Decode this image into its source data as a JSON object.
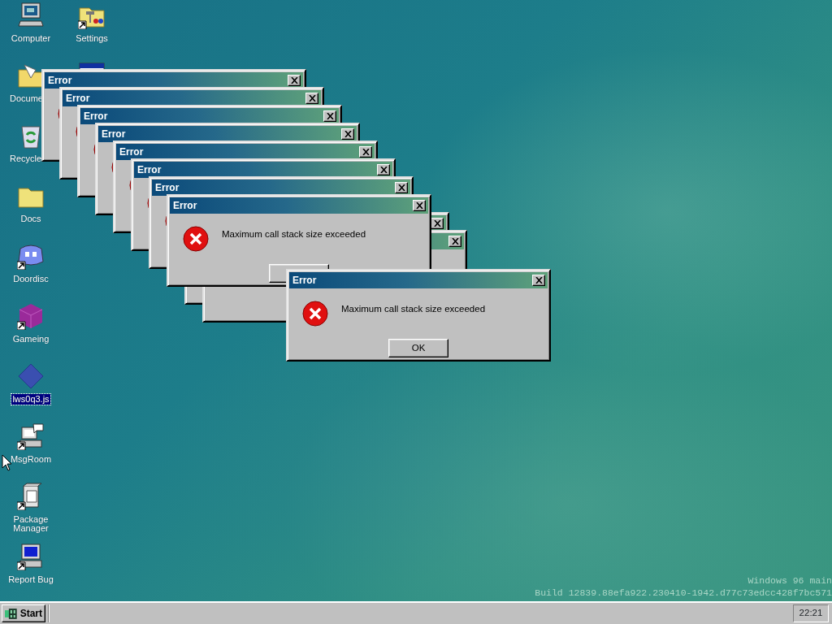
{
  "desktop": {
    "icon_columns": [
      [
        {
          "label": "Computer",
          "kind": "computer",
          "shortcut": false,
          "selected": false,
          "truncated": false
        },
        {
          "label": "Docume",
          "kind": "documents",
          "shortcut": false,
          "selected": false,
          "truncated": true
        },
        {
          "label": "Recycle",
          "kind": "recycle",
          "shortcut": false,
          "selected": false,
          "truncated": true
        },
        {
          "label": "Docs",
          "kind": "folder",
          "shortcut": false,
          "selected": false,
          "truncated": false
        },
        {
          "label": "Doordisc",
          "kind": "chat",
          "shortcut": true,
          "selected": false,
          "truncated": false
        },
        {
          "label": "Gameing",
          "kind": "cube",
          "shortcut": true,
          "selected": false,
          "truncated": false
        },
        {
          "label": "lws0q3.js",
          "kind": "script",
          "shortcut": false,
          "selected": true,
          "truncated": false
        },
        {
          "label": "MsgRoom",
          "kind": "messenger",
          "shortcut": true,
          "selected": false,
          "truncated": false
        },
        {
          "label": "Package Manager",
          "kind": "package",
          "shortcut": true,
          "selected": false,
          "truncated": false
        },
        {
          "label": "Report Bug",
          "kind": "monitor",
          "shortcut": true,
          "selected": false,
          "truncated": false
        }
      ],
      [
        {
          "label": "Settings",
          "kind": "settings",
          "shortcut": true,
          "selected": false,
          "truncated": false
        },
        {
          "kind": "program"
        }
      ]
    ],
    "build_info": [
      "Windows 96 main",
      "Build 12839.88efa922.230410-1942.d77c73edcc428f7bc571"
    ]
  },
  "windows": [
    {
      "title": "Error"
    },
    {
      "title": "Error"
    },
    {
      "title": "Error"
    },
    {
      "title": "Error"
    },
    {
      "title": "Error"
    },
    {
      "title": "Error"
    },
    {
      "title": "Error"
    },
    {
      "title": "Error",
      "message": "Maximum call stack size exceeded"
    },
    {
      "covered": true
    },
    {
      "covered": true
    },
    {
      "title": "Error",
      "message": "Maximum call stack size exceeded",
      "button": "OK"
    }
  ],
  "taskbar": {
    "start": "Start",
    "clock": "22:21"
  }
}
